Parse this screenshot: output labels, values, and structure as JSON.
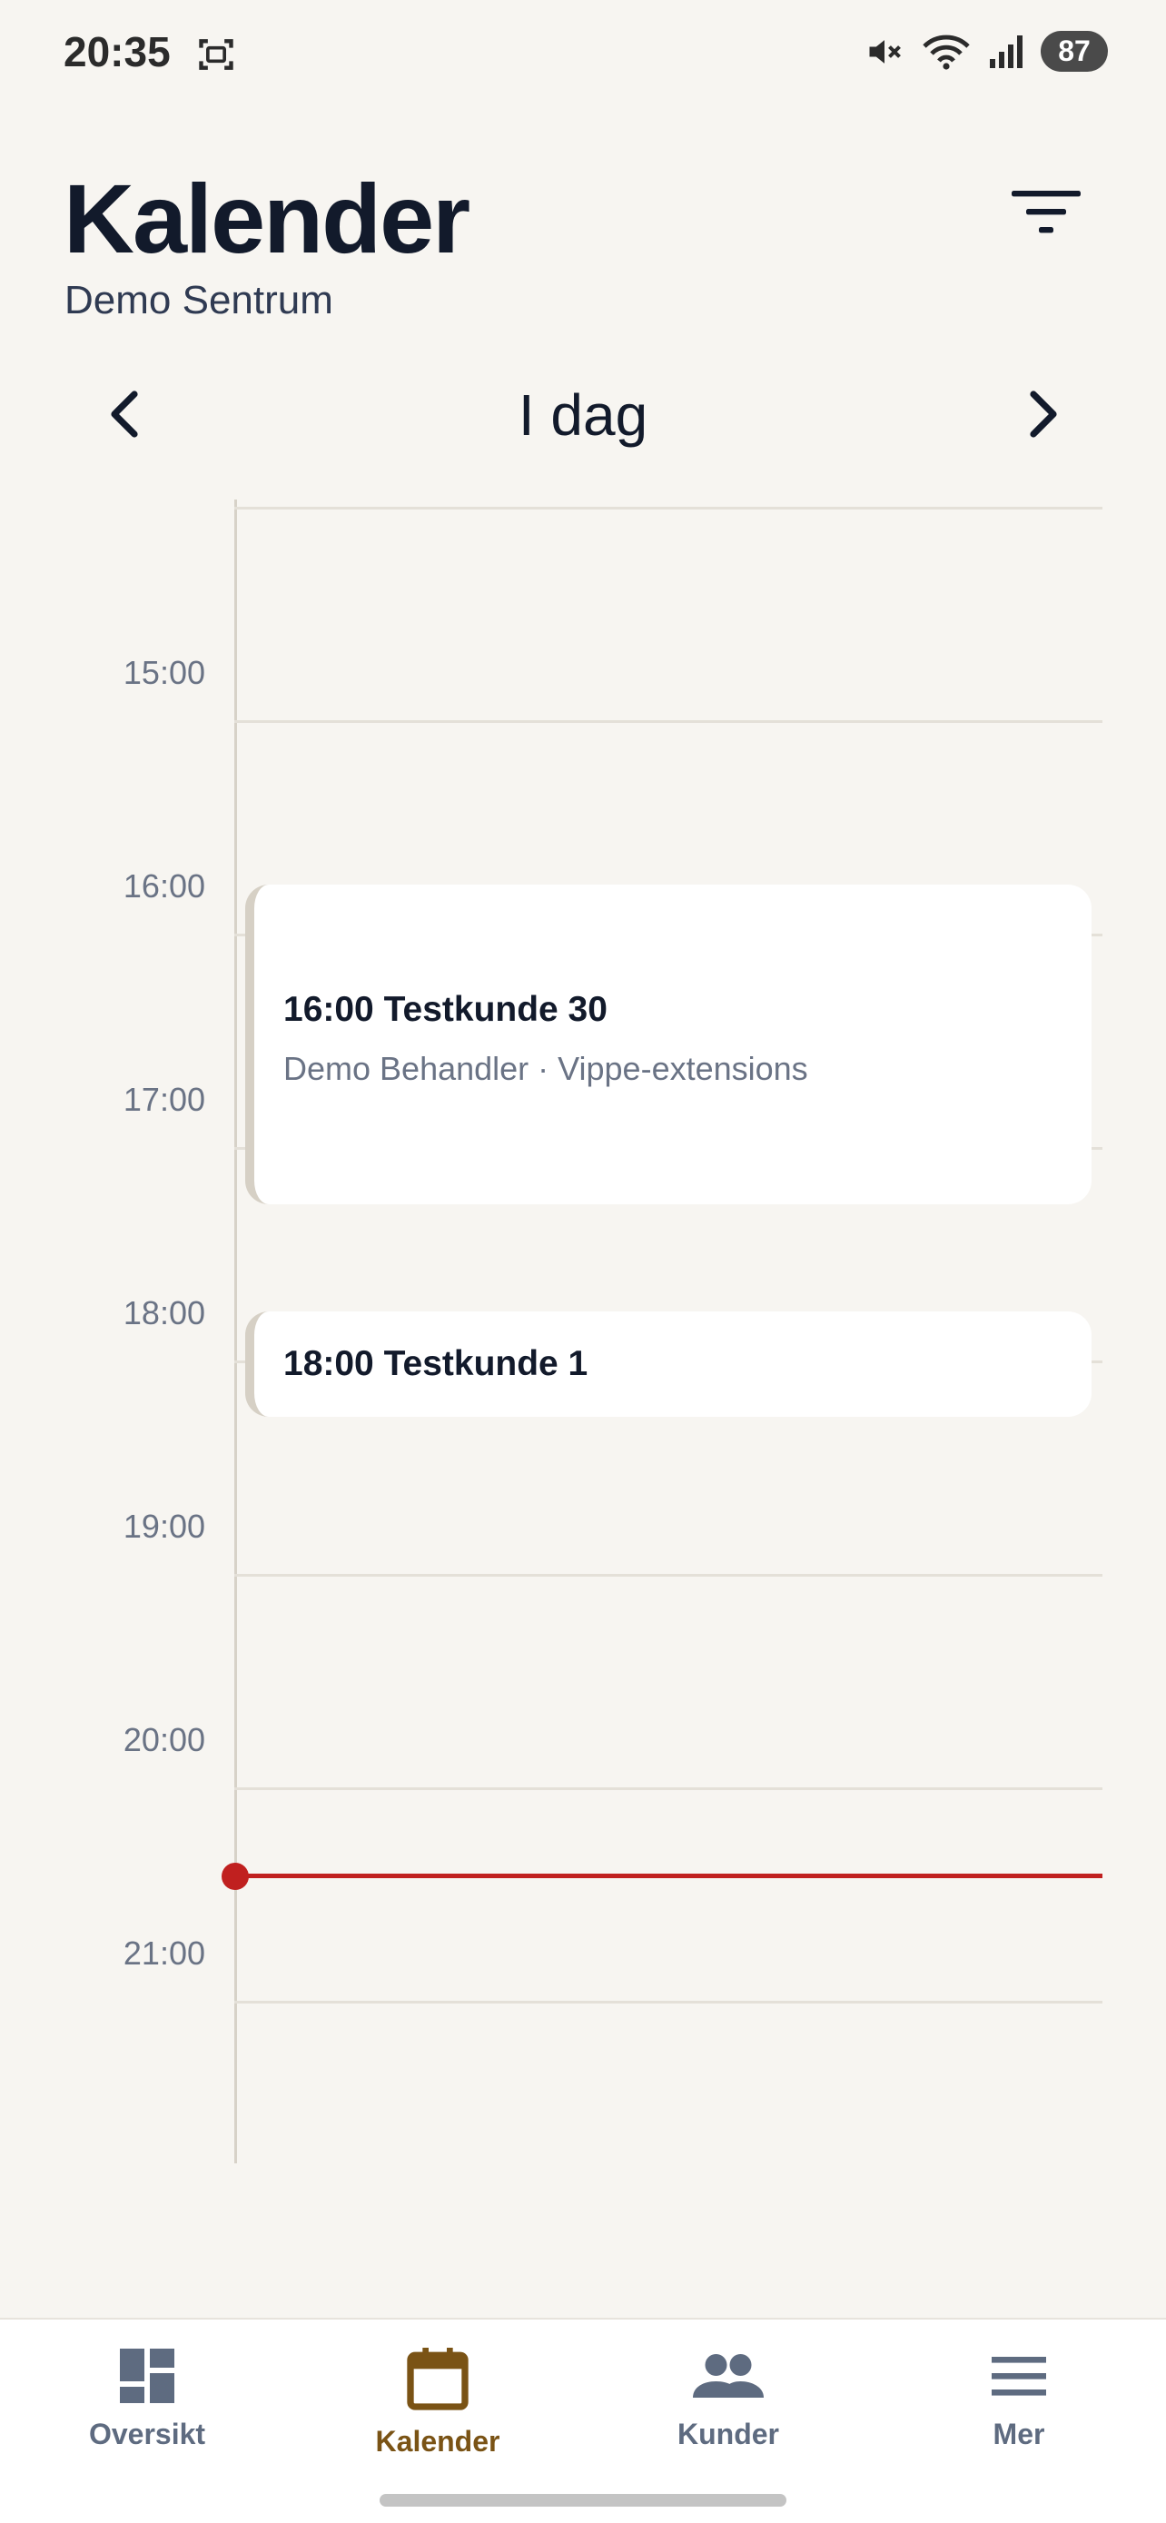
{
  "status_bar": {
    "time": "20:35",
    "battery": "87",
    "icons": [
      "screenshot-icon",
      "mute-icon",
      "wifi-icon",
      "signal-icon"
    ]
  },
  "header": {
    "title": "Kalender",
    "subtitle": "Demo Sentrum",
    "filter_icon": "filter-icon"
  },
  "date_nav": {
    "label": "I dag",
    "prev_icon": "chevron-left-icon",
    "next_icon": "chevron-right-icon"
  },
  "timeline": {
    "hours": [
      "15:00",
      "16:00",
      "17:00",
      "18:00",
      "19:00",
      "20:00",
      "21:00"
    ],
    "events": [
      {
        "title": "16:00 Testkunde 30",
        "subtitle": "Demo Behandler · Vippe-extensions"
      },
      {
        "title": "18:00 Testkunde 1"
      }
    ],
    "now_color": "#c0201f"
  },
  "bottom_nav": {
    "items": [
      {
        "label": "Oversikt",
        "icon": "dashboard-icon"
      },
      {
        "label": "Kalender",
        "icon": "calendar-icon",
        "active": true
      },
      {
        "label": "Kunder",
        "icon": "people-icon"
      },
      {
        "label": "Mer",
        "icon": "menu-icon"
      }
    ],
    "active_color": "#7a5315",
    "inactive_color": "#5e6b80"
  }
}
